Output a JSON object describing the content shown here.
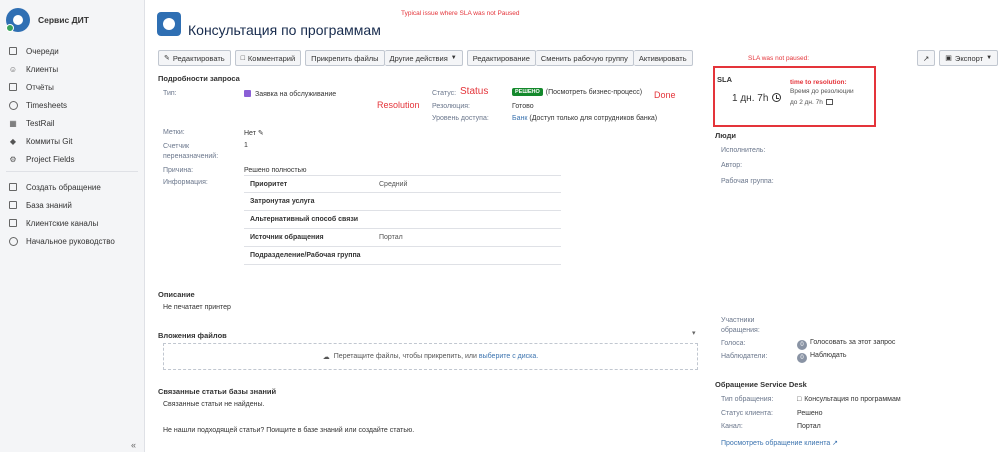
{
  "sidebar": {
    "brand": "Сервис ДИТ",
    "items_top": [
      {
        "label": "Очереди",
        "icon": "queues-icon"
      },
      {
        "label": "Клиенты",
        "icon": "customers-icon"
      },
      {
        "label": "Отчёты",
        "icon": "reports-icon"
      },
      {
        "label": "Timesheets",
        "icon": "timesheets-icon"
      },
      {
        "label": "TestRail",
        "icon": "testrail-icon"
      },
      {
        "label": "Коммиты Git",
        "icon": "git-icon"
      },
      {
        "label": "Project Fields",
        "icon": "project-fields-icon"
      }
    ],
    "items_bottom": [
      {
        "label": "Создать обращение",
        "icon": "create-request-icon"
      },
      {
        "label": "База знаний",
        "icon": "knowledge-base-icon"
      },
      {
        "label": "Клиентские каналы",
        "icon": "channels-icon"
      },
      {
        "label": "Начальное руководство",
        "icon": "getting-started-icon"
      }
    ],
    "collapse": "«"
  },
  "annotations": {
    "top": "Typical issue where SLA was not Paused",
    "status": "Status",
    "resolution": "Resolution",
    "done": "Done",
    "sla_not_paused": "SLA was not paused:",
    "time_to_resolution": "time to resolution:"
  },
  "header": {
    "title": "Консультация по программам"
  },
  "toolbar": {
    "edit": "Редактировать",
    "comment": "Комментарий",
    "attach": "Прикрепить файлы",
    "other": "Другие действия",
    "editing": "Редактирование",
    "change_group": "Сменить рабочую группу",
    "activate": "Активировать",
    "export": "Экспорт"
  },
  "details": {
    "title": "Подробности запроса",
    "type_label": "Тип:",
    "type_value": "Заявка на обслуживание",
    "status_label": "Статус:",
    "status_badge": "РЕШЕНО",
    "status_link": "(Посмотреть бизнес-процесс)",
    "resolution_label": "Резолюция:",
    "resolution_value": "Готово",
    "access_label": "Уровень доступа:",
    "access_value_link": "Банк",
    "access_value_rest": "(Доступ только для сотрудников банка)",
    "labels_label": "Метки:",
    "labels_value": "Нет",
    "counter_label": "Счетчик переназначений:",
    "counter_value": "1",
    "reason_label": "Причина:",
    "reason_value": "Решено полностью",
    "info_label": "Информация:",
    "info_rows": [
      {
        "k": "Приоритет",
        "v": "Средний"
      },
      {
        "k": "Затронутая услуга",
        "v": ""
      },
      {
        "k": "Альтернативный способ связи",
        "v": ""
      },
      {
        "k": "Источник обращения",
        "v": "Портал"
      },
      {
        "k": "Подразделение/Рабочая группа",
        "v": ""
      }
    ]
  },
  "description": {
    "title": "Описание",
    "text": "Не печатает принтер"
  },
  "attachments": {
    "title": "Вложения файлов",
    "drop_text": "Перетащите файлы, чтобы прикрепить, или",
    "drop_link": "выберите с диска."
  },
  "kb": {
    "title": "Связанные статьи базы знаний",
    "none": "Связанные статьи не найдены.",
    "prompt": "Не нашли подходящей статьи? Поищите в базе знаний или создайте статью."
  },
  "sla": {
    "title": "SLA",
    "time": "1 дн. 7h",
    "caption": "Время до резолюции",
    "goal": "до 2 дн. 7h"
  },
  "people": {
    "title": "Люди",
    "assignee": "Исполнитель:",
    "reporter": "Автор:",
    "group": "Рабочая группа:",
    "participants": "Участники обращения:",
    "votes_label": "Голоса:",
    "votes_count": "0",
    "votes_link": "Голосовать за этот запрос",
    "watchers_label": "Наблюдатели:",
    "watchers_count": "0",
    "watchers_link": "Наблюдать"
  },
  "service_desk": {
    "title": "Обращение Service Desk",
    "type_label": "Тип обращения:",
    "type_value": "Консультация по программам",
    "status_label": "Статус клиента:",
    "status_value": "Решено",
    "channel_label": "Канал:",
    "channel_value": "Портал",
    "view_link": "Просмотреть обращение клиента"
  }
}
